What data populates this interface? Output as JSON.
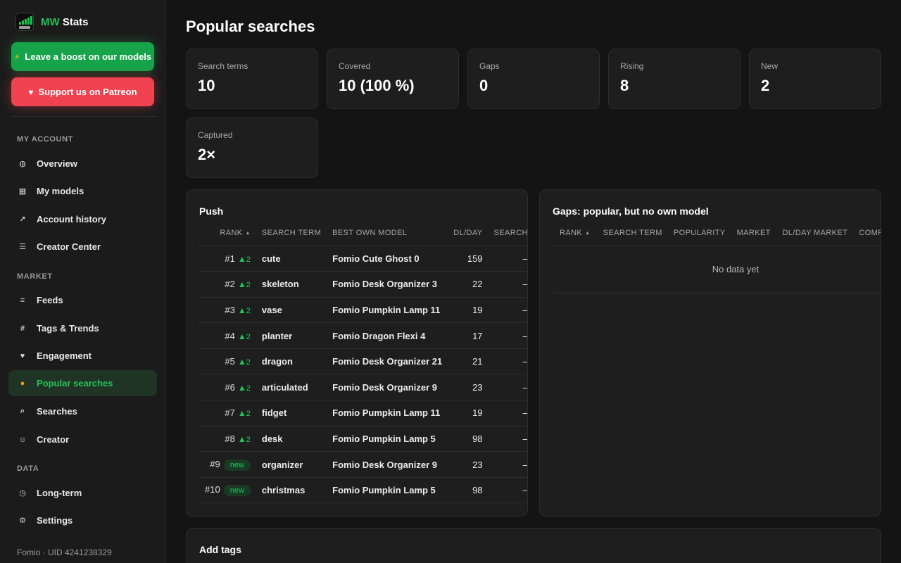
{
  "brand": {
    "accent": "MW",
    "name": "Stats"
  },
  "cta": {
    "boost": "Leave a boost on our models",
    "patreon": "Support us on Patreon"
  },
  "sidebar": {
    "sections": {
      "account": "MY ACCOUNT",
      "market": "MARKET",
      "data": "DATA"
    },
    "items": [
      {
        "label": "Overview",
        "icon": "globe-icon"
      },
      {
        "label": "My models",
        "icon": "grid-icon"
      },
      {
        "label": "Account history",
        "icon": "trend-arrow-icon"
      },
      {
        "label": "Creator Center",
        "icon": "list-icon"
      },
      {
        "label": "Feeds",
        "icon": "menu-icon"
      },
      {
        "label": "Tags & Trends",
        "icon": "hashtag-icon"
      },
      {
        "label": "Engagement",
        "icon": "heart-icon"
      },
      {
        "label": "Popular searches",
        "icon": "fire-icon",
        "active": true
      },
      {
        "label": "Searches",
        "icon": "search-icon"
      },
      {
        "label": "Creator",
        "icon": "smiley-icon"
      },
      {
        "label": "Long-term",
        "icon": "clock-icon"
      },
      {
        "label": "Settings",
        "icon": "gear-icon"
      }
    ],
    "footer": "Fomio · UID 4241238329"
  },
  "page": {
    "title": "Popular searches"
  },
  "stats": [
    {
      "label": "Search terms",
      "value": "10"
    },
    {
      "label": "Covered",
      "value": "10 (100 %)"
    },
    {
      "label": "Gaps",
      "value": "0"
    },
    {
      "label": "Rising",
      "value": "8"
    },
    {
      "label": "New",
      "value": "2"
    },
    {
      "label": "Captured",
      "value": "2×"
    }
  ],
  "push": {
    "title": "Push",
    "columns": [
      "RANK",
      "SEARCH TERM",
      "BEST OWN MODEL",
      "DL/DAY",
      "SEARCH"
    ],
    "rows": [
      {
        "rank": "#1",
        "change": "2",
        "term": "cute",
        "model": "Fomio Cute Ghost 0",
        "dl": "159",
        "search": "–"
      },
      {
        "rank": "#2",
        "change": "2",
        "term": "skeleton",
        "model": "Fomio Desk Organizer 3",
        "dl": "22",
        "search": "–"
      },
      {
        "rank": "#3",
        "change": "2",
        "term": "vase",
        "model": "Fomio Pumpkin Lamp 11",
        "dl": "19",
        "search": "–"
      },
      {
        "rank": "#4",
        "change": "2",
        "term": "planter",
        "model": "Fomio Dragon Flexi 4",
        "dl": "17",
        "search": "–"
      },
      {
        "rank": "#5",
        "change": "2",
        "term": "dragon",
        "model": "Fomio Desk Organizer 21",
        "dl": "21",
        "search": "–"
      },
      {
        "rank": "#6",
        "change": "2",
        "term": "articulated",
        "model": "Fomio Desk Organizer 9",
        "dl": "23",
        "search": "–"
      },
      {
        "rank": "#7",
        "change": "2",
        "term": "fidget",
        "model": "Fomio Pumpkin Lamp 11",
        "dl": "19",
        "search": "–"
      },
      {
        "rank": "#8",
        "change": "2",
        "term": "desk",
        "model": "Fomio Pumpkin Lamp 5",
        "dl": "98",
        "search": "–"
      },
      {
        "rank": "#9",
        "badge": "new",
        "term": "organizer",
        "model": "Fomio Desk Organizer 9",
        "dl": "23",
        "search": "–"
      },
      {
        "rank": "#10",
        "badge": "new",
        "term": "christmas",
        "model": "Fomio Pumpkin Lamp 5",
        "dl": "98",
        "search": "–"
      }
    ]
  },
  "gaps": {
    "title": "Gaps: popular, but no own model",
    "columns": [
      "RANK",
      "SEARCH TERM",
      "POPULARITY",
      "MARKET",
      "DL/DAY MARKET",
      "COMPE"
    ],
    "empty": "No data yet"
  },
  "tags": {
    "title": "Add tags"
  },
  "colors": {
    "accent": "#22c55e",
    "boost": "#16a34a",
    "patreon": "#f0424f",
    "bg": "#141414",
    "card": "#1e1e1e"
  }
}
